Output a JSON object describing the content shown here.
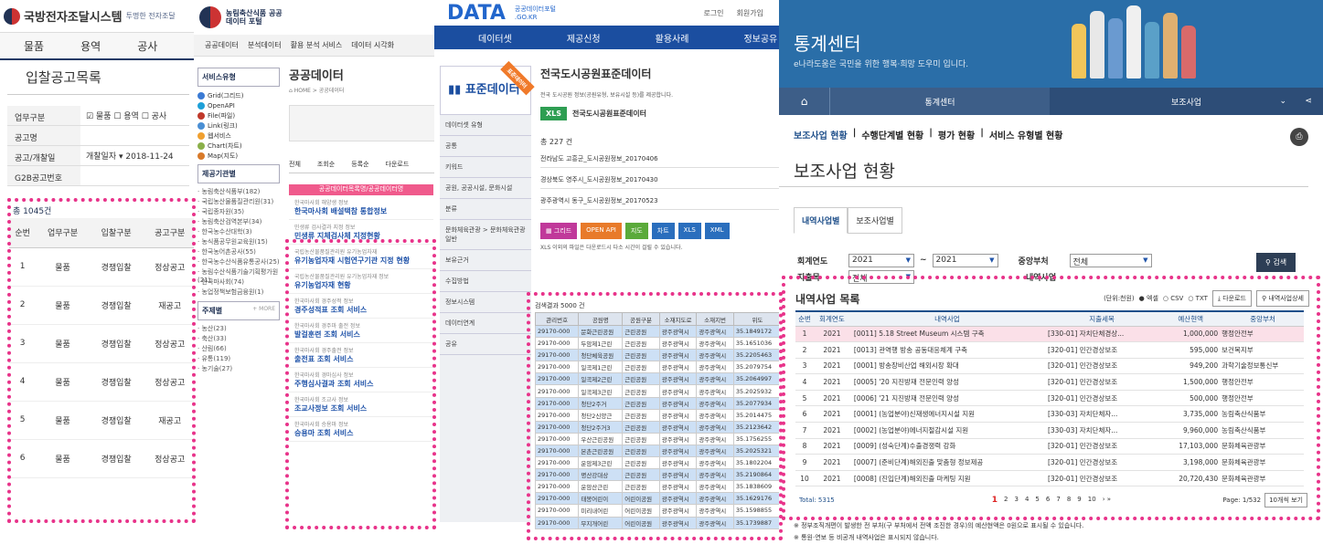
{
  "p1": {
    "title": "국방전자조달시스템",
    "slogan": "투명한 전자조달",
    "nav": [
      "물품",
      "용역",
      "공사"
    ],
    "page_title": "입찰공고목록",
    "form": [
      {
        "label": "업무구분",
        "value": "☑ 물품 ☐ 용역 ☐ 공사"
      },
      {
        "label": "공고명",
        "value": ""
      },
      {
        "label": "공고/개찰일",
        "value": "개찰일자 ▾ 2018-11-24"
      },
      {
        "label": "G2B공고번호",
        "value": ""
      }
    ],
    "total": "총 1045건",
    "cols": [
      "순번",
      "업무구분",
      "입찰구분",
      "공고구분"
    ],
    "rows": [
      [
        "1",
        "물품",
        "경쟁입찰",
        "정상공고"
      ],
      [
        "2",
        "물품",
        "경쟁입찰",
        "재공고"
      ],
      [
        "3",
        "물품",
        "경쟁입찰",
        "정상공고"
      ],
      [
        "4",
        "물품",
        "경쟁입찰",
        "정상공고"
      ],
      [
        "5",
        "물품",
        "경쟁입찰",
        "재공고"
      ],
      [
        "6",
        "물품",
        "경쟁입찰",
        "정상공고"
      ]
    ]
  },
  "p2": {
    "title": "농림축산식품 공공데이터 포털",
    "nav": [
      "공공데이터",
      "분석데이터",
      "활용 분석 서비스",
      "데이터 시각화"
    ],
    "svc_head": "서비스유형",
    "svc": [
      {
        "n": "Grid(그리드)",
        "c": "#3b7bd4"
      },
      {
        "n": "OpenAPI",
        "c": "#1ea0d8"
      },
      {
        "n": "File(파일)",
        "c": "#c0392b"
      },
      {
        "n": "Link(링크)",
        "c": "#4a8fd4"
      },
      {
        "n": "웹서비스",
        "c": "#f0a030"
      },
      {
        "n": "Chart(차트)",
        "c": "#8bb04a"
      },
      {
        "n": "Map(지도)",
        "c": "#d87a2a"
      }
    ],
    "org_head": "제공기관별",
    "orgs": [
      "농림축산식품부(182)",
      "국립농산물품질관리원(31)",
      "국립종자원(35)",
      "농림축산검역본부(34)",
      "한국농수산대학(3)",
      "농식품공무원교육원(15)",
      "한국농어촌공사(55)",
      "한국농수산식품유통공사(25)",
      "농림수산식품기술기획평가원(21)",
      "한국마사회(74)",
      "농업정책보험금융원(1)"
    ],
    "topic_head": "주제별",
    "topics": [
      "농산(23)",
      "축산(33)",
      "산림(66)",
      "유통(119)",
      "농기술(27)"
    ],
    "more": "+ MORE",
    "main_title": "공공데이터",
    "crumb": "⌂ HOME > 공공데이터",
    "tabs": [
      "전체",
      "조회순",
      "등록순",
      "다운로드"
    ],
    "list_head": "공공데이터목록명/공공데이터명",
    "entries": [
      {
        "s": "한국마사회 해양생 정보",
        "t": "한국마사회 배설택참 통합정보"
      },
      {
        "s": "민생류 검사결과 지정 정보",
        "t": "민생류 지체검사체 지정현황"
      },
      {
        "s": "국립농산물품질관리원 유기농업자재",
        "t": "유기농업자재 시험연구기관 지정 현황"
      },
      {
        "s": "국립농산물품질관리원 유기농업자재 정보",
        "t": "유기농업자재 현황"
      },
      {
        "s": "한국마사회 경주성적 정보",
        "t": "경주성적표 조회 서비스"
      },
      {
        "s": "한국마사회 경주마 출전 정보",
        "t": "발걸훈련 조회 서비스"
      },
      {
        "s": "한국마사회 경주출전 정보",
        "t": "출전표 조회 서비스"
      },
      {
        "s": "한국마사회 경마심사 정보",
        "t": "주행심사결과 조회 서비스"
      },
      {
        "s": "한국마사회 조교사 정보",
        "t": "조교사정보 조회 서비스"
      },
      {
        "s": "한국마사회 승용마 정보",
        "t": "승용마 조회 서비스"
      }
    ]
  },
  "p3": {
    "logo": "DATA",
    "logo_sub": "공공데이터포털 .GO.KR",
    "toplinks": [
      "로그인",
      "회원가입"
    ],
    "nav": [
      "데이터셋",
      "제공신청",
      "활용사례",
      "정보공유"
    ],
    "side_title": "표준데이터",
    "ribbon": "표준데이터",
    "side": [
      "데이터셋 유형",
      "공통",
      "키워드",
      "공원, 공공시설, 문화시설",
      "분류",
      "문화체육관광 > 문화체육관광일반",
      "보유근거",
      "수집방법",
      "정보시스템",
      "데이터연계",
      "공유"
    ],
    "title": "전국도시공원표준데이터",
    "desc": "전국 도시공원 정보(공원유형, 보유시설 등)를 제공합니다.",
    "xls": "XLS",
    "xls_title": "전국도시공원표준데이터",
    "count": "총 227 건",
    "files": [
      "전라남도 고흥군_도시공원정보_20170406",
      "경상북도 영주시_도시공원정보_20170430",
      "광주광역시 동구_도시공원정보_20170523"
    ],
    "btns": [
      {
        "l": "▦ 그리드",
        "c": "#c0399a"
      },
      {
        "l": "OPEN API",
        "c": "#e87a2a"
      },
      {
        "l": "지도",
        "c": "#5aaa3a"
      },
      {
        "l": "차트",
        "c": "#2a6ebd"
      },
      {
        "l": "XLS",
        "c": "#2a6ebd"
      },
      {
        "l": "XML",
        "c": "#2a6ebd"
      }
    ],
    "note": "XLS 이외의 파일은 다운로드시 다소 시간이 걸릴 수 있습니다.",
    "grid_caption": "검색결과 5000 건",
    "grid_cols": [
      "관리번호",
      "공원명",
      "공원구분",
      "소재지도로",
      "소재지번",
      "위도"
    ],
    "grid_rows": [
      [
        "29170-000",
        "문화근린공원",
        "근린공원",
        "광주광역시",
        "광주광역시",
        "35.1849172"
      ],
      [
        "29170-000",
        "두암제1근린",
        "근린공원",
        "광주광역시",
        "광주광역시",
        "35.1651036"
      ],
      [
        "29170-000",
        "청단체육공원",
        "근린공원",
        "광주광역시",
        "광주광역시",
        "35.2205463"
      ],
      [
        "29170-000",
        "일곡제1근린",
        "근린공원",
        "광주광역시",
        "광주광역시",
        "35.2079754"
      ],
      [
        "29170-000",
        "일곡제2근린",
        "근린공원",
        "광주광역시",
        "광주광역시",
        "35.2064997"
      ],
      [
        "29170-000",
        "일곡제3근린",
        "근린공원",
        "광주광역시",
        "광주광역시",
        "35.2025932"
      ],
      [
        "29170-000",
        "청단2주거",
        "근린공원",
        "광주광역시",
        "광주광역시",
        "35.2077934"
      ],
      [
        "29170-000",
        "청단2신양근",
        "근린공원",
        "광주광역시",
        "광주광역시",
        "35.2014475"
      ],
      [
        "29170-000",
        "청단2주거3",
        "근린공원",
        "광주광역시",
        "광주광역시",
        "35.2123642"
      ],
      [
        "29170-000",
        "우산근린공원",
        "근린공원",
        "광주광역시",
        "광주광역시",
        "35.1756255"
      ],
      [
        "29170-000",
        "본촌근린공원",
        "근린공원",
        "광주광역시",
        "광주광역시",
        "35.2025321"
      ],
      [
        "29170-000",
        "운암제3근린",
        "근린공원",
        "광주광역시",
        "광주광역시",
        "35.1802204"
      ],
      [
        "29170-000",
        "명산강대상",
        "근린공원",
        "광주광역시",
        "광주광역시",
        "35.2190864"
      ],
      [
        "29170-000",
        "운암산근린",
        "근린공원",
        "광주광역시",
        "광주광역시",
        "35.1838609"
      ],
      [
        "29170-000",
        "태봉어린이",
        "어린이공원",
        "광주광역시",
        "광주광역시",
        "35.1629176"
      ],
      [
        "29170-000",
        "미리내어린",
        "어린이공원",
        "광주광역시",
        "광주광역시",
        "35.1598855"
      ],
      [
        "29170-000",
        "무지개어린",
        "어린이공원",
        "광주광역시",
        "광주광역시",
        "35.1739887"
      ]
    ]
  },
  "p4": {
    "title": "통계센터",
    "subtitle": "e나라도움은 국민을 위한 행복·희망 도우미 입니다.",
    "menu1": "통계센터",
    "menu2": "보조사업",
    "crumbs": [
      "보조사업 현황",
      "수행단계별 현황",
      "평가 현황",
      "서비스 유형별 현황"
    ],
    "page_title": "보조사업 현황",
    "tabs": [
      "내역사업별",
      "보조사업별"
    ],
    "f_year": "회계연도",
    "y1": "2021",
    "y2": "2021",
    "f_dept": "중앙부처",
    "dept": "전체",
    "f_acct": "지출목",
    "acct": "전체",
    "f_biz": "내역사업",
    "search": "검색",
    "list_title": "내역사업 목록",
    "unit": "(단위:천원)",
    "fmt": [
      "● 엑셀",
      "○ CSV",
      "○ TXT"
    ],
    "download": "다운로드",
    "detail": "내역사업상세",
    "cols": [
      "순번",
      "회계연도",
      "내역사업",
      "지출세목",
      "예산현액",
      "중앙부처"
    ],
    "rows": [
      [
        "1",
        "2021",
        "[0011] 5.18 Street Museum 시스템 구축",
        "[330-01] 자치단체경상...",
        "1,000,000",
        "행정안전부"
      ],
      [
        "2",
        "2021",
        "[0013] 관역행 방송 공동대응체계 구축",
        "[320-01] 민간경상보조",
        "595,000",
        "보건복지부"
      ],
      [
        "3",
        "2021",
        "[0001] 방송장비산업 해외시장 확대",
        "[320-01] 민간경상보조",
        "949,200",
        "과학기술정보통신부"
      ],
      [
        "4",
        "2021",
        "[0005] '20 지진방재 전문인력 양성",
        "[320-01] 민간경상보조",
        "1,500,000",
        "행정안전부"
      ],
      [
        "5",
        "2021",
        "[0006] '21 지진방재 전문인력 양성",
        "[320-01] 민간경상보조",
        "500,000",
        "행정안전부"
      ],
      [
        "6",
        "2021",
        "[0001] (농업분야)신재생에너지시설 지원",
        "[330-03] 자치단체자...",
        "3,735,000",
        "농림축산식품부"
      ],
      [
        "7",
        "2021",
        "[0002] (농업분야)에너지절감시설 지원",
        "[330-03] 자치단체자...",
        "9,960,000",
        "농림축산식품부"
      ],
      [
        "8",
        "2021",
        "[0009] (성숙단계)수출경쟁력 강화",
        "[320-01] 민간경상보조",
        "17,103,000",
        "문화체육관광부"
      ],
      [
        "9",
        "2021",
        "[0007] (준비단계)해외진출 맞춤형 정보제공",
        "[320-01] 민간경상보조",
        "3,198,000",
        "문화체육관광부"
      ],
      [
        "10",
        "2021",
        "[0008] (진입단계)해외진출 마케팅 지원",
        "[320-01] 민간경상보조",
        "20,720,430",
        "문화체육관광부"
      ]
    ],
    "total": "Total: 5315",
    "pages": [
      "1",
      "2",
      "3",
      "4",
      "5",
      "6",
      "7",
      "8",
      "9",
      "10"
    ],
    "page_info": "Page: 1/532",
    "per_page": "10개씩 보기",
    "notes": [
      "※ 정부조직개편이 발생한 전 부처(구 부처에서 전액 조진한 경우)의 예산현액은 0원으로 표시될 수 있습니다.",
      "※ 통원·연보 등 비공개 내역사업은 표시되지 않습니다."
    ]
  }
}
